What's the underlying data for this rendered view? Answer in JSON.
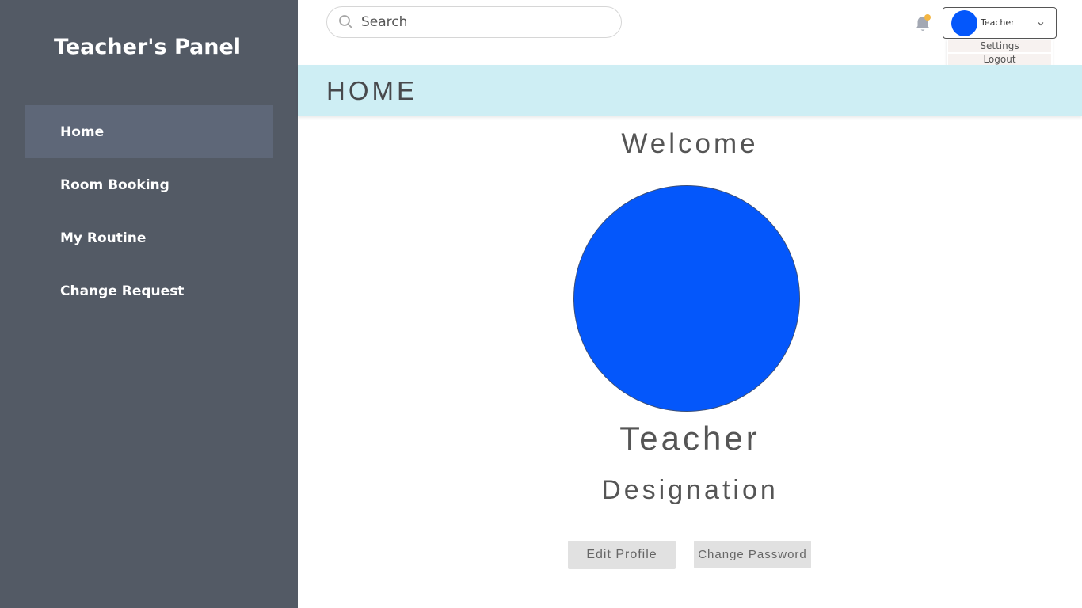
{
  "sidebar": {
    "title": "Teacher's Panel",
    "items": [
      {
        "label": "Home",
        "active": true
      },
      {
        "label": "Room Booking",
        "active": false
      },
      {
        "label": "My Routine",
        "active": false
      },
      {
        "label": "Change Request",
        "active": false
      }
    ]
  },
  "topbar": {
    "search": {
      "placeholder": "Search",
      "value": "",
      "icon": "search-icon"
    },
    "notifications": {
      "icon": "bell-icon",
      "has_unread": true,
      "dot_color": "#f4b642"
    },
    "user_menu": {
      "name": "Teacher",
      "avatar_color": "#0457fb",
      "icon": "chevron-down-icon",
      "dropdown": [
        "Settings",
        "Logout"
      ]
    }
  },
  "header": {
    "title": "HOME",
    "background": "#ceeef4"
  },
  "profile": {
    "welcome": "Welcome",
    "avatar_color": "#0457fb",
    "name": "Teacher",
    "designation": "Designation",
    "buttons": {
      "edit_profile": "Edit Profile",
      "change_password": "Change Password"
    }
  },
  "colors": {
    "sidebar_bg": "#535a65",
    "sidebar_active": "#5e6778",
    "accent": "#0457fb"
  }
}
